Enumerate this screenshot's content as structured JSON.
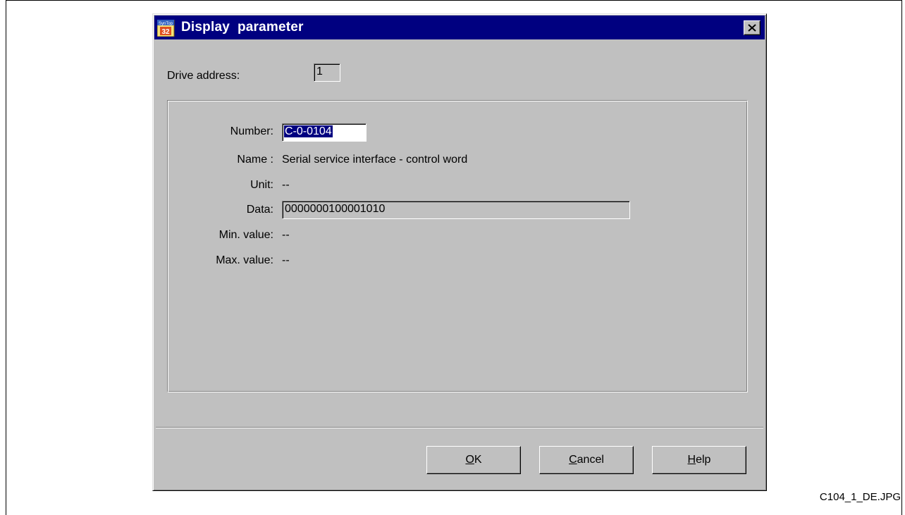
{
  "window": {
    "title": "Display  parameter",
    "icon_text_top": "SynTop",
    "icon_text_bottom": "32"
  },
  "drive": {
    "label": "Drive address:",
    "value": "1"
  },
  "params": {
    "number_label": "Number:",
    "number_value": "C-0-0104",
    "name_label": "Name :",
    "name_value": "Serial service interface - control word",
    "unit_label": "Unit:",
    "unit_value": "--",
    "data_label": "Data:",
    "data_value": "0000000100001010",
    "min_label": "Min. value:",
    "min_value": "--",
    "max_label": "Max. value:",
    "max_value": "--"
  },
  "buttons": {
    "ok_mnemonic": "O",
    "ok_rest": "K",
    "cancel_mnemonic": "C",
    "cancel_rest": "ancel",
    "help_mnemonic": "H",
    "help_rest": "elp"
  },
  "caption": "C104_1_DE.JPG",
  "colors": {
    "titlebar": "#000080",
    "dialog_bg": "#c0c0c0",
    "selection": "#000080"
  },
  "icons": [
    "app-icon",
    "close-icon"
  ]
}
